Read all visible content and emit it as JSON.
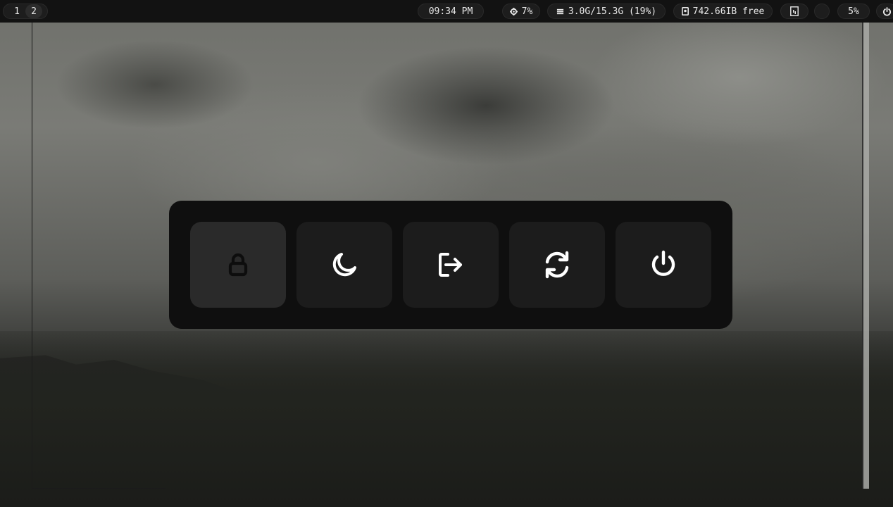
{
  "topbar": {
    "workspaces": [
      {
        "label": "1",
        "active": false
      },
      {
        "label": "2",
        "active": true
      }
    ],
    "clock": "09:34 PM",
    "cpu": {
      "icon": "cpu-icon",
      "value": "7%"
    },
    "memory": {
      "icon": "memory-icon",
      "value": "3.0G/15.3G (19%)"
    },
    "disk": {
      "icon": "disk-icon",
      "value": "742.66IB free"
    },
    "tray_icon": "display-icon",
    "volume": {
      "value": "5%"
    },
    "power_icon": "power-icon"
  },
  "power_menu": {
    "buttons": [
      {
        "icon": "lock-icon",
        "selected": true
      },
      {
        "icon": "moon-icon",
        "selected": false
      },
      {
        "icon": "logout-icon",
        "selected": false
      },
      {
        "icon": "reboot-icon",
        "selected": false
      },
      {
        "icon": "shutdown-icon",
        "selected": false
      }
    ]
  },
  "colors": {
    "bar_bg": "#121212",
    "pill_bg": "#1d1d1d",
    "menu_bg": "#0f0f0f",
    "button_bg": "#1c1c1c",
    "button_selected_bg": "#2a2a2a",
    "icon_color": "#ffffff",
    "icon_selected_color": "#0d0d0d"
  }
}
